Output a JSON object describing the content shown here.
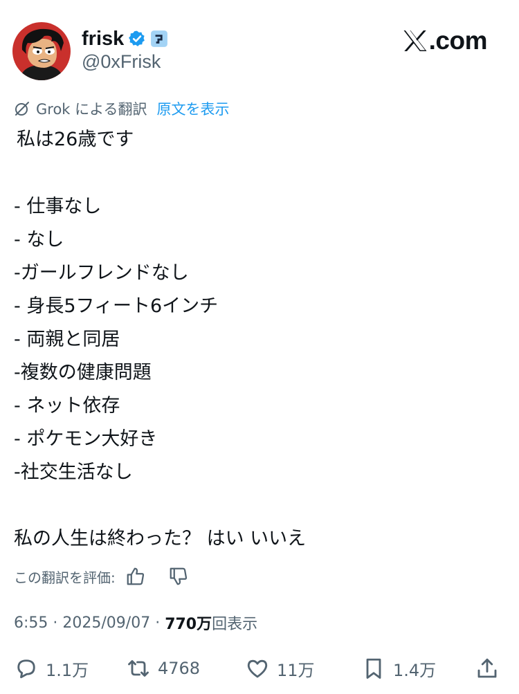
{
  "profile": {
    "name": "frisk",
    "handle": "@0xFrisk",
    "avatar_icon": "cartoon-avatar",
    "verified_icon": "verified-badge-icon",
    "affiliation_icon": "affiliate-badge-icon"
  },
  "brand": {
    "text": ".com",
    "icon": "x-logo-icon"
  },
  "translation": {
    "label": "Grok による翻訳",
    "show_original": "原文を表示",
    "icon": "grok-icon"
  },
  "post": {
    "lines": [
      "私は26歳です",
      "- 仕事なし",
      "- なし",
      "-ガールフレンドなし",
      "- 身長5フィート6インチ",
      "- 両親と同居",
      "-複数の健康問題",
      "- ネット依存",
      "- ポケモン大好き",
      "-社交生活なし",
      "私の人生は終わった？ はい いいえ"
    ]
  },
  "rating": {
    "label": "この翻訳を評価:",
    "thumbs_up_icon": "thumbs-up-icon",
    "thumbs_down_icon": "thumbs-down-icon"
  },
  "meta": {
    "time": "6:55",
    "date": "2025/09/07",
    "views_count": "770万",
    "views_label": "回表示"
  },
  "actions": {
    "replies": "1.1万",
    "reposts": "4768",
    "likes": "11万",
    "bookmarks": "1.4万"
  },
  "colors": {
    "text": "#0f1419",
    "secondary": "#536471",
    "link": "#1d9bf0",
    "verified": "#1d9bf0",
    "affiliate_bg": "#a3d3f5"
  }
}
